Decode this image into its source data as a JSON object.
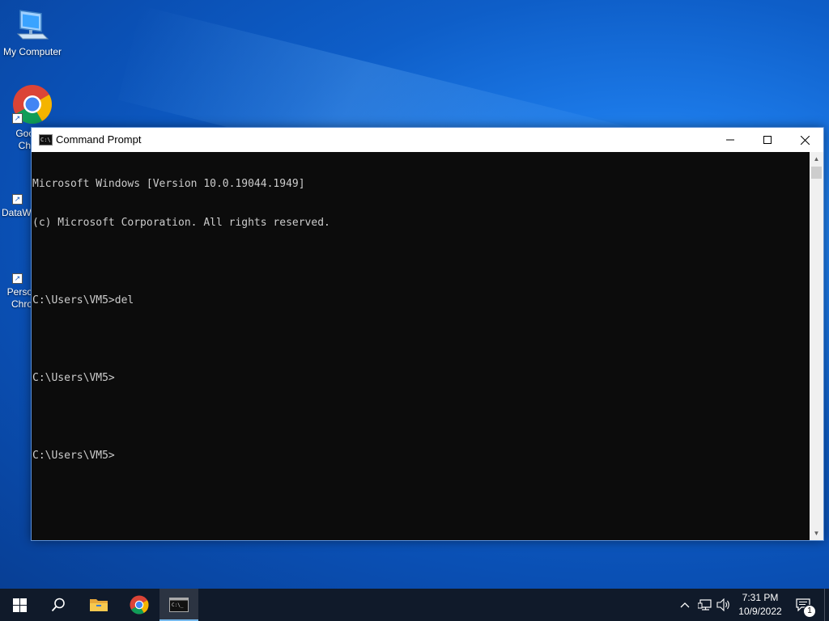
{
  "desktop": {
    "icons": [
      {
        "label": "My Computer",
        "icon": "computer-icon"
      },
      {
        "label": "Goo Chr",
        "icon": "chrome-icon"
      },
      {
        "label": "DataW",
        "icon": "datawrapper-icon"
      },
      {
        "label": "Perso Chro",
        "icon": "document-icon"
      }
    ]
  },
  "window": {
    "title": "Command Prompt",
    "icon": "cmd-icon",
    "controls": {
      "minimize": "minimize-icon",
      "maximize": "maximize-icon",
      "close": "close-icon"
    }
  },
  "terminal": {
    "lines": [
      "Microsoft Windows [Version 10.0.19044.1949]",
      "(c) Microsoft Corporation. All rights reserved.",
      "",
      "C:\\Users\\VM5>del",
      "",
      "C:\\Users\\VM5>",
      "",
      "C:\\Users\\VM5>"
    ]
  },
  "taskbar": {
    "buttons": [
      {
        "name": "start",
        "icon": "windows-icon"
      },
      {
        "name": "search",
        "icon": "search-icon"
      },
      {
        "name": "file-explorer",
        "icon": "folder-icon"
      },
      {
        "name": "chrome",
        "icon": "chrome-icon"
      },
      {
        "name": "command-prompt",
        "icon": "cmd-icon",
        "active": true
      }
    ],
    "tray": {
      "time": "7:31 PM",
      "date": "10/9/2022",
      "notification_count": "1"
    }
  },
  "colors": {
    "terminal_bg": "#0c0c0c",
    "terminal_fg": "#cccccc",
    "taskbar_bg": "#101a2a",
    "accent": "#76b9ed"
  }
}
